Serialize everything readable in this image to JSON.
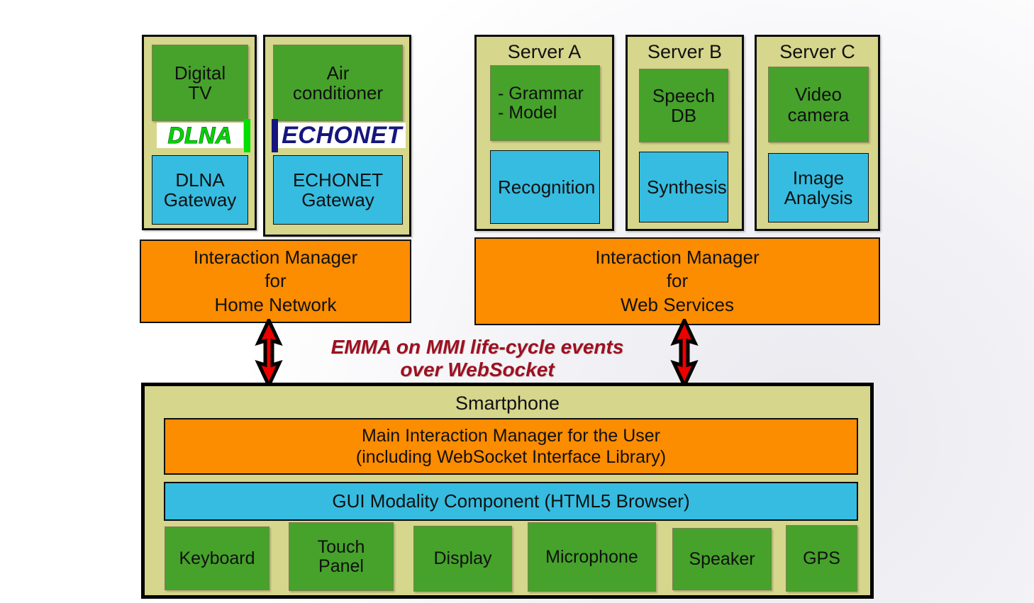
{
  "diagram": {
    "title": "Multimodal architecture with Interaction Managers, home network devices, web service servers and a smartphone",
    "colors": {
      "device_panel": "#d6d68c",
      "green_block": "#46a22b",
      "cyan_block": "#36bce0",
      "orange_block": "#fc8c00",
      "arrow": "#ee0000",
      "emma_text": "#9e1020",
      "dlna_text": "#00d400",
      "echonet_text": "#16167e",
      "border": "#0d0d0d"
    }
  },
  "home_devices": [
    {
      "device_label": "Digital\nTV",
      "device_line1": "Digital",
      "device_line2": "TV",
      "protocol": "DLNA",
      "gateway_line1": "DLNA",
      "gateway_line2": "Gateway"
    },
    {
      "device_label": "Air conditioner",
      "device_line1": "Air",
      "device_line2": "conditioner",
      "protocol": "ECHONET",
      "gateway_line1": "ECHONET",
      "gateway_line2": "Gateway"
    }
  ],
  "servers": [
    {
      "title": "Server A",
      "resource_line1": "- Grammar",
      "resource_line2": "- Model",
      "component": "Recognition"
    },
    {
      "title": "Server B",
      "resource_line1": "Speech",
      "resource_line2": "DB",
      "component": "Synthesis"
    },
    {
      "title": "Server C",
      "resource_line1": "Video",
      "resource_line2": "camera",
      "component_line1": "Image",
      "component_line2": "Analysis"
    }
  ],
  "interaction_managers": [
    {
      "line1": "Interaction Manager",
      "line2": "for",
      "line3": "Home Network"
    },
    {
      "line1": "Interaction Manager",
      "line2": "for",
      "line3": "Web Services"
    }
  ],
  "connection": {
    "label_line1": "EMMA on MMI life-cycle events",
    "label_line2": "over WebSocket",
    "arrow_type": "double-headed-vertical"
  },
  "smartphone": {
    "title": "Smartphone",
    "main_im_line1": "Main Interaction Manager for the User",
    "main_im_line2": "(including WebSocket Interface Library)",
    "gui_component": "GUI Modality Component (HTML5 Browser)",
    "modalities": [
      {
        "line1": "Keyboard",
        "line2": ""
      },
      {
        "line1": "Touch",
        "line2": "Panel"
      },
      {
        "line1": "Display",
        "line2": ""
      },
      {
        "line1": "Microphone",
        "line2": ""
      },
      {
        "line1": "Speaker",
        "line2": ""
      },
      {
        "line1": "GPS",
        "line2": ""
      }
    ]
  }
}
